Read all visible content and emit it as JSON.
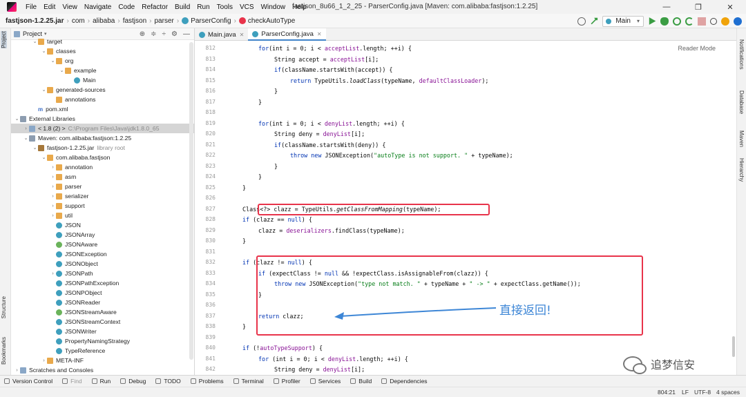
{
  "menu": {
    "items": [
      "File",
      "Edit",
      "View",
      "Navigate",
      "Code",
      "Refactor",
      "Build",
      "Run",
      "Tools",
      "VCS",
      "Window",
      "Help"
    ],
    "window_title": "fastjson_8u66_1_2_25 - ParserConfig.java [Maven: com.alibaba:fastjson:1.2.25]",
    "controls": [
      "—",
      "❐",
      "✕"
    ]
  },
  "breadcrumb": [
    "fastjson-1.2.25.jar",
    "com",
    "alibaba",
    "fastjson",
    "parser",
    "ParserConfig",
    "checkAutoType"
  ],
  "run_config": "Main",
  "left_tabs": [
    "Project",
    "Structure",
    "Bookmarks"
  ],
  "right_tabs": [
    "Notifications",
    "Database",
    "Maven",
    "Hierarchy"
  ],
  "project_panel": {
    "title": "Project",
    "tools": [
      "⊕",
      "≑",
      "÷",
      "⚙",
      "—"
    ],
    "tree": [
      {
        "indent": 2,
        "arrow": "⌄",
        "icon": "folder",
        "label": "target",
        "sub": ""
      },
      {
        "indent": 3,
        "arrow": "⌄",
        "icon": "folder",
        "label": "classes",
        "sub": ""
      },
      {
        "indent": 4,
        "arrow": "⌄",
        "icon": "folder",
        "label": "org",
        "sub": ""
      },
      {
        "indent": 5,
        "arrow": "⌄",
        "icon": "folder",
        "label": "example",
        "sub": ""
      },
      {
        "indent": 6,
        "arrow": "",
        "icon": "cls",
        "label": "Main",
        "sub": ""
      },
      {
        "indent": 3,
        "arrow": "⌄",
        "icon": "folder",
        "label": "generated-sources",
        "sub": ""
      },
      {
        "indent": 4,
        "arrow": "",
        "icon": "folder",
        "label": "annotations",
        "sub": ""
      },
      {
        "indent": 2,
        "arrow": "",
        "icon": "mvn",
        "label": "pom.xml",
        "sub": ""
      },
      {
        "indent": 0,
        "arrow": "⌄",
        "icon": "lib",
        "label": "External Libraries",
        "sub": ""
      },
      {
        "indent": 1,
        "arrow": "›",
        "icon": "folder-b",
        "label": "< 1.8 (2) >",
        "sub": "C:\\Program Files\\Java\\jdk1.8.0_65",
        "sel": true
      },
      {
        "indent": 1,
        "arrow": "⌄",
        "icon": "lib",
        "label": "Maven: com.alibaba:fastjson:1.2.25",
        "sub": ""
      },
      {
        "indent": 2,
        "arrow": "⌄",
        "icon": "jar",
        "label": "fastjson-1.2.25.jar",
        "sub": "library root"
      },
      {
        "indent": 3,
        "arrow": "⌄",
        "icon": "folder",
        "label": "com.alibaba.fastjson",
        "sub": ""
      },
      {
        "indent": 4,
        "arrow": "›",
        "icon": "folder",
        "label": "annotation",
        "sub": ""
      },
      {
        "indent": 4,
        "arrow": "›",
        "icon": "folder",
        "label": "asm",
        "sub": ""
      },
      {
        "indent": 4,
        "arrow": "›",
        "icon": "folder",
        "label": "parser",
        "sub": ""
      },
      {
        "indent": 4,
        "arrow": "›",
        "icon": "folder",
        "label": "serializer",
        "sub": ""
      },
      {
        "indent": 4,
        "arrow": "›",
        "icon": "folder",
        "label": "support",
        "sub": ""
      },
      {
        "indent": 4,
        "arrow": "›",
        "icon": "folder",
        "label": "util",
        "sub": ""
      },
      {
        "indent": 4,
        "arrow": "",
        "icon": "cls",
        "label": "JSON",
        "sub": ""
      },
      {
        "indent": 4,
        "arrow": "",
        "icon": "cls",
        "label": "JSONArray",
        "sub": ""
      },
      {
        "indent": 4,
        "arrow": "",
        "icon": "iface",
        "label": "JSONAware",
        "sub": ""
      },
      {
        "indent": 4,
        "arrow": "",
        "icon": "cls",
        "label": "JSONException",
        "sub": ""
      },
      {
        "indent": 4,
        "arrow": "",
        "icon": "cls",
        "label": "JSONObject",
        "sub": ""
      },
      {
        "indent": 4,
        "arrow": "›",
        "icon": "cls",
        "label": "JSONPath",
        "sub": ""
      },
      {
        "indent": 4,
        "arrow": "",
        "icon": "cls",
        "label": "JSONPathException",
        "sub": ""
      },
      {
        "indent": 4,
        "arrow": "",
        "icon": "cls",
        "label": "JSONPObject",
        "sub": ""
      },
      {
        "indent": 4,
        "arrow": "",
        "icon": "cls",
        "label": "JSONReader",
        "sub": ""
      },
      {
        "indent": 4,
        "arrow": "",
        "icon": "iface",
        "label": "JSONStreamAware",
        "sub": ""
      },
      {
        "indent": 4,
        "arrow": "",
        "icon": "cls",
        "label": "JSONStreamContext",
        "sub": ""
      },
      {
        "indent": 4,
        "arrow": "",
        "icon": "cls",
        "label": "JSONWriter",
        "sub": ""
      },
      {
        "indent": 4,
        "arrow": "",
        "icon": "cls",
        "label": "PropertyNamingStrategy",
        "sub": ""
      },
      {
        "indent": 4,
        "arrow": "",
        "icon": "cls",
        "label": "TypeReference",
        "sub": ""
      },
      {
        "indent": 3,
        "arrow": "›",
        "icon": "folder",
        "label": "META-INF",
        "sub": ""
      },
      {
        "indent": 0,
        "arrow": "›",
        "icon": "folder-b",
        "label": "Scratches and Consoles",
        "sub": ""
      }
    ]
  },
  "editor": {
    "tabs": [
      {
        "label": "Main.java",
        "active": false
      },
      {
        "label": "ParserConfig.java",
        "active": true
      }
    ],
    "reader_mode": "Reader Mode",
    "lines": [
      {
        "n": "812",
        "i": 2,
        "seg": [
          [
            "kw",
            "for"
          ],
          [
            "",
            "(int i = 0; i < "
          ],
          [
            "fld",
            "acceptList"
          ],
          [
            "",
            ".length; ++i) {"
          ]
        ]
      },
      {
        "n": "813",
        "i": 3,
        "seg": [
          [
            "",
            "String accept = "
          ],
          [
            "fld",
            "acceptList"
          ],
          [
            "",
            "[i];"
          ]
        ]
      },
      {
        "n": "814",
        "i": 3,
        "seg": [
          [
            "kw",
            "if"
          ],
          [
            "",
            "(className.startsWith(accept)) {"
          ]
        ]
      },
      {
        "n": "815",
        "i": 4,
        "seg": [
          [
            "kw",
            "return"
          ],
          [
            "",
            " TypeUtils."
          ],
          [
            "it",
            "loadClass"
          ],
          [
            "",
            "(typeName, "
          ],
          [
            "fld",
            "defaultClassLoader"
          ],
          [
            "",
            ");"
          ]
        ]
      },
      {
        "n": "816",
        "i": 3,
        "seg": [
          [
            "",
            "}"
          ]
        ]
      },
      {
        "n": "817",
        "i": 2,
        "seg": [
          [
            "",
            "}"
          ]
        ]
      },
      {
        "n": "818",
        "i": 0,
        "seg": []
      },
      {
        "n": "819",
        "i": 2,
        "seg": [
          [
            "kw",
            "for"
          ],
          [
            "",
            "(int i = 0; i < "
          ],
          [
            "fld",
            "denyList"
          ],
          [
            "",
            ".length; ++i) {"
          ]
        ]
      },
      {
        "n": "820",
        "i": 3,
        "seg": [
          [
            "",
            "String deny = "
          ],
          [
            "fld",
            "denyList"
          ],
          [
            "",
            "[i];"
          ]
        ]
      },
      {
        "n": "821",
        "i": 3,
        "seg": [
          [
            "kw",
            "if"
          ],
          [
            "",
            "(className.startsWith(deny)) {"
          ]
        ]
      },
      {
        "n": "822",
        "i": 4,
        "seg": [
          [
            "kw",
            "throw new"
          ],
          [
            "",
            " JSONException("
          ],
          [
            "str",
            "\"autoType is not support. \""
          ],
          [
            "",
            " + typeName);"
          ]
        ]
      },
      {
        "n": "823",
        "i": 3,
        "seg": [
          [
            "",
            "}"
          ]
        ]
      },
      {
        "n": "824",
        "i": 2,
        "seg": [
          [
            "",
            "}"
          ]
        ]
      },
      {
        "n": "825",
        "i": 1,
        "seg": [
          [
            "",
            "}"
          ]
        ]
      },
      {
        "n": "826",
        "i": 0,
        "seg": []
      },
      {
        "n": "827",
        "i": 1,
        "seg": [
          [
            "",
            "Class<?> clazz = TypeUtils."
          ],
          [
            "it",
            "getClassFromMapping"
          ],
          [
            "",
            "(typeName);"
          ]
        ]
      },
      {
        "n": "828",
        "i": 1,
        "seg": [
          [
            "kw",
            "if"
          ],
          [
            "",
            " (clazz == "
          ],
          [
            "kw",
            "null"
          ],
          [
            "",
            ") {"
          ]
        ]
      },
      {
        "n": "829",
        "i": 2,
        "seg": [
          [
            "",
            "clazz = "
          ],
          [
            "fld",
            "deserializers"
          ],
          [
            "",
            ".findClass(typeName);"
          ]
        ]
      },
      {
        "n": "830",
        "i": 1,
        "seg": [
          [
            "",
            "}"
          ]
        ]
      },
      {
        "n": "831",
        "i": 0,
        "seg": []
      },
      {
        "n": "832",
        "i": 1,
        "seg": [
          [
            "kw",
            "if"
          ],
          [
            "",
            " (clazz != "
          ],
          [
            "kw",
            "null"
          ],
          [
            "",
            ") {"
          ]
        ]
      },
      {
        "n": "833",
        "i": 2,
        "seg": [
          [
            "kw",
            "if"
          ],
          [
            "",
            " (expectClass != "
          ],
          [
            "kw",
            "null"
          ],
          [
            "",
            " && !expectClass.isAssignableFrom(clazz)) {"
          ]
        ]
      },
      {
        "n": "834",
        "i": 3,
        "seg": [
          [
            "kw",
            "throw new"
          ],
          [
            "",
            " JSONException("
          ],
          [
            "str",
            "\"type not match. \""
          ],
          [
            "",
            " + typeName + "
          ],
          [
            "str",
            "\" -> \""
          ],
          [
            "",
            " + expectClass.getName());"
          ]
        ]
      },
      {
        "n": "835",
        "i": 2,
        "seg": [
          [
            "",
            "}"
          ]
        ]
      },
      {
        "n": "836",
        "i": 0,
        "seg": []
      },
      {
        "n": "837",
        "i": 2,
        "seg": [
          [
            "kw",
            "return"
          ],
          [
            "",
            " clazz;"
          ]
        ]
      },
      {
        "n": "838",
        "i": 1,
        "seg": [
          [
            "",
            "}"
          ]
        ]
      },
      {
        "n": "839",
        "i": 0,
        "seg": []
      },
      {
        "n": "840",
        "i": 1,
        "seg": [
          [
            "kw",
            "if"
          ],
          [
            "",
            " (!"
          ],
          [
            "fld",
            "autoTypeSupport"
          ],
          [
            "",
            ") {"
          ]
        ]
      },
      {
        "n": "841",
        "i": 2,
        "seg": [
          [
            "kw",
            "for"
          ],
          [
            "",
            " (int i = 0; i < "
          ],
          [
            "fld",
            "denyList"
          ],
          [
            "",
            ".length; ++i) {"
          ]
        ]
      },
      {
        "n": "842",
        "i": 3,
        "seg": [
          [
            "",
            "String deny = "
          ],
          [
            "fld",
            "denyList"
          ],
          [
            "",
            "[i];"
          ]
        ]
      }
    ],
    "annotation": "直接返回!"
  },
  "bottom_tools": [
    {
      "label": "Version Control",
      "dim": false
    },
    {
      "label": "Find",
      "dim": true
    },
    {
      "label": "Run",
      "dim": false
    },
    {
      "label": "Debug",
      "dim": false
    },
    {
      "label": "TODO",
      "dim": false
    },
    {
      "label": "Problems",
      "dim": false
    },
    {
      "label": "Terminal",
      "dim": false
    },
    {
      "label": "Profiler",
      "dim": false
    },
    {
      "label": "Services",
      "dim": false
    },
    {
      "label": "Build",
      "dim": false
    },
    {
      "label": "Dependencies",
      "dim": false
    }
  ],
  "status": {
    "position": "804:21",
    "line_sep": "LF",
    "encoding": "UTF-8",
    "indent": "4 spaces"
  },
  "watermark": "追梦信安",
  "colors": {
    "keyword": "#0033b3",
    "field": "#871094",
    "string": "#067d17",
    "highlight": "#e8334a",
    "annotation": "#3d86d6"
  }
}
